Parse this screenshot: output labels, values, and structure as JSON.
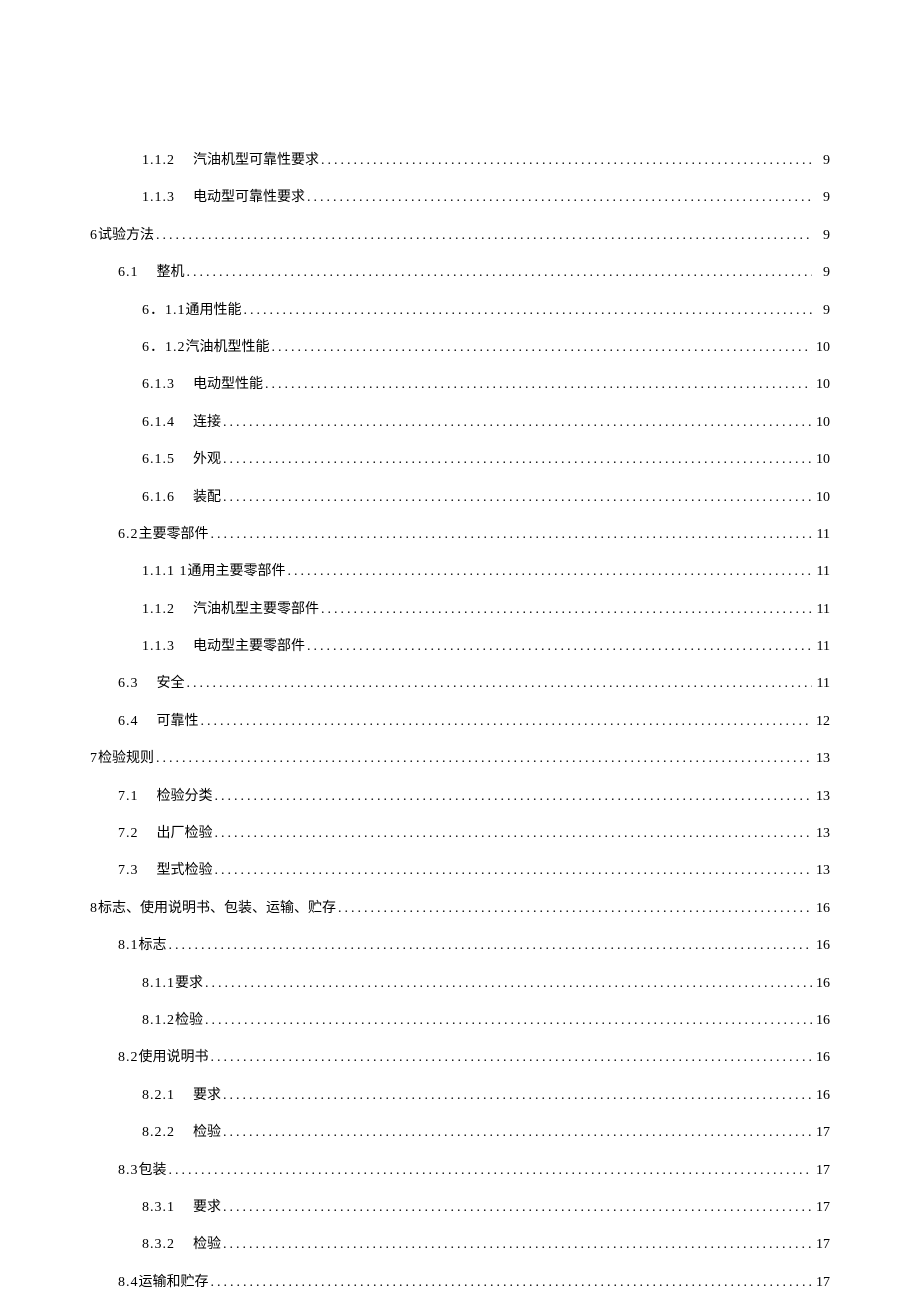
{
  "toc": [
    {
      "indent": 2,
      "num": "1.1.2",
      "gap": "big",
      "title": "汽油机型可靠性要求",
      "page": "9"
    },
    {
      "indent": 2,
      "num": "1.1.3",
      "gap": "big",
      "title": "电动型可靠性要求",
      "page": "9"
    },
    {
      "indent": 0,
      "num": "6",
      "gap": "none",
      "title": "试验方法",
      "page": "9"
    },
    {
      "indent": 1,
      "num": "6.1",
      "gap": "big",
      "title": "整机",
      "page": "9"
    },
    {
      "indent": 2,
      "num": "6．1.1",
      "gap": "none",
      "title": "通用性能",
      "page": "9"
    },
    {
      "indent": 2,
      "num": "6．1.2",
      "gap": "none",
      "title": "汽油机型性能",
      "page": "10"
    },
    {
      "indent": 2,
      "num": "6.1.3",
      "gap": "big",
      "title": "电动型性能",
      "page": "10"
    },
    {
      "indent": 2,
      "num": "6.1.4",
      "gap": "big",
      "title": "连接",
      "page": "10"
    },
    {
      "indent": 2,
      "num": "6.1.5",
      "gap": "big",
      "title": "外观",
      "page": "10"
    },
    {
      "indent": 2,
      "num": "6.1.6",
      "gap": "big",
      "title": "装配",
      "page": "10"
    },
    {
      "indent": 1,
      "num": "6.2",
      "gap": "none",
      "title": "主要零部件",
      "page": "11"
    },
    {
      "indent": 2,
      "num": "1.1.1 1",
      "gap": "none",
      "title": "通用主要零部件",
      "page": "11"
    },
    {
      "indent": 2,
      "num": "1.1.2",
      "gap": "big",
      "title": "汽油机型主要零部件",
      "page": "11"
    },
    {
      "indent": 2,
      "num": "1.1.3",
      "gap": "big",
      "title": "电动型主要零部件",
      "page": "11"
    },
    {
      "indent": 1,
      "num": "6.3",
      "gap": "big",
      "title": "安全",
      "page": "11"
    },
    {
      "indent": 1,
      "num": "6.4",
      "gap": "big",
      "title": "可靠性",
      "page": "12"
    },
    {
      "indent": 0,
      "num": "7",
      "gap": "none",
      "title": "检验规则",
      "page": "13"
    },
    {
      "indent": 1,
      "num": "7.1",
      "gap": "big",
      "title": "检验分类",
      "page": "13"
    },
    {
      "indent": 1,
      "num": "7.2",
      "gap": "big",
      "title": "出厂检验",
      "page": "13"
    },
    {
      "indent": 1,
      "num": "7.3",
      "gap": "big",
      "title": "型式检验",
      "page": "13"
    },
    {
      "indent": 0,
      "num": "8",
      "gap": "none",
      "title": "标志、使用说明书、包装、运输、贮存",
      "page": "16"
    },
    {
      "indent": 1,
      "num": "8.1",
      "gap": "none",
      "title": "标志",
      "page": "16"
    },
    {
      "indent": 2,
      "num": "8.1.1",
      "gap": "none",
      "title": "要求",
      "page": "16"
    },
    {
      "indent": 2,
      "num": "8.1.2",
      "gap": "none",
      "title": "检验",
      "page": "16"
    },
    {
      "indent": 1,
      "num": "8.2",
      "gap": "none",
      "title": "使用说明书",
      "page": "16"
    },
    {
      "indent": 2,
      "num": "8.2.1",
      "gap": "big",
      "title": "要求",
      "page": "16"
    },
    {
      "indent": 2,
      "num": "8.2.2",
      "gap": "big",
      "title": "检验",
      "page": "17"
    },
    {
      "indent": 1,
      "num": "8.3",
      "gap": "none",
      "title": "包装",
      "page": "17"
    },
    {
      "indent": 2,
      "num": "8.3.1",
      "gap": "big",
      "title": "要求",
      "page": "17"
    },
    {
      "indent": 2,
      "num": "8.3.2",
      "gap": "big",
      "title": "检验",
      "page": "17"
    },
    {
      "indent": 1,
      "num": "8.4",
      "gap": "none",
      "title": "运输和贮存",
      "page": "17"
    }
  ]
}
